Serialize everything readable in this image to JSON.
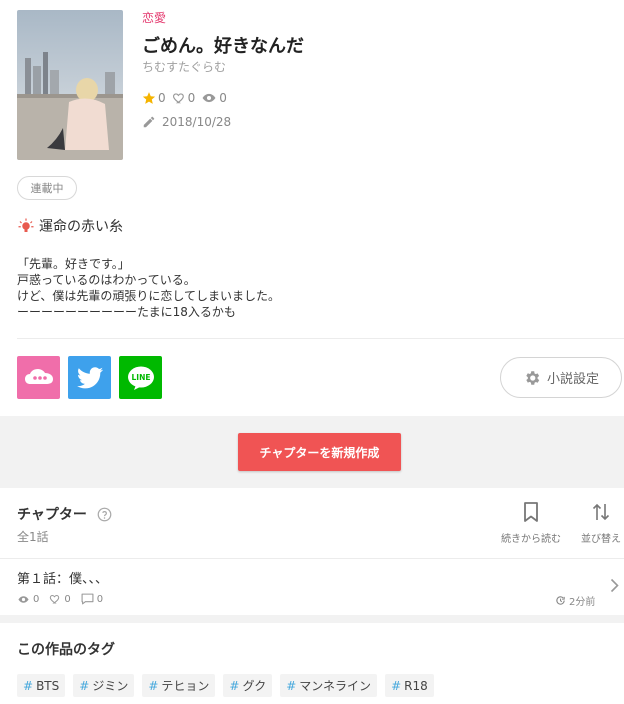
{
  "novel": {
    "genre": "恋愛",
    "title": "ごめん。好きなんだ",
    "author": "ちむすたぐらむ",
    "stats": {
      "stars": "0",
      "likes": "0",
      "views": "0"
    },
    "updated": "2018/10/28",
    "status": "連載中",
    "catchphrase": "運命の赤い糸",
    "synopsis": [
      "「先輩。好きです。」",
      "戸惑っているのはわかっている。",
      "けど、僕は先輩の頑張りに恋してしまいました。",
      "ーーーーーーーーーーたまに18入るかも"
    ]
  },
  "share": {
    "pink_icon": "cloud-chat-icon",
    "twitter_icon": "twitter-bird-icon",
    "line_label": "LINE"
  },
  "settings": {
    "label": "小説設定",
    "icon": "gear-icon"
  },
  "create_chapter": {
    "label": "チャプターを新規作成"
  },
  "chapters": {
    "heading": "チャプター",
    "count": "全1話",
    "continue_label": "続きから読む",
    "sort_label": "並び替え",
    "items": [
      {
        "title": "第１話：僕、、、",
        "views": "0",
        "likes": "0",
        "comments": "0",
        "time": "2分前"
      }
    ]
  },
  "tags": {
    "heading": "この作品のタグ",
    "hash": "#",
    "items": [
      "BTS",
      "ジミン",
      "テヒョン",
      "グク",
      "マンネライン",
      "R18"
    ]
  },
  "colors": {
    "genre": "#e4386e",
    "create_button": "#f05454",
    "twitter": "#3ea1ec",
    "line": "#00b900",
    "pink_share": "#f06eaa",
    "tag_hash": "#46a8dc",
    "star": "#f5b400"
  }
}
